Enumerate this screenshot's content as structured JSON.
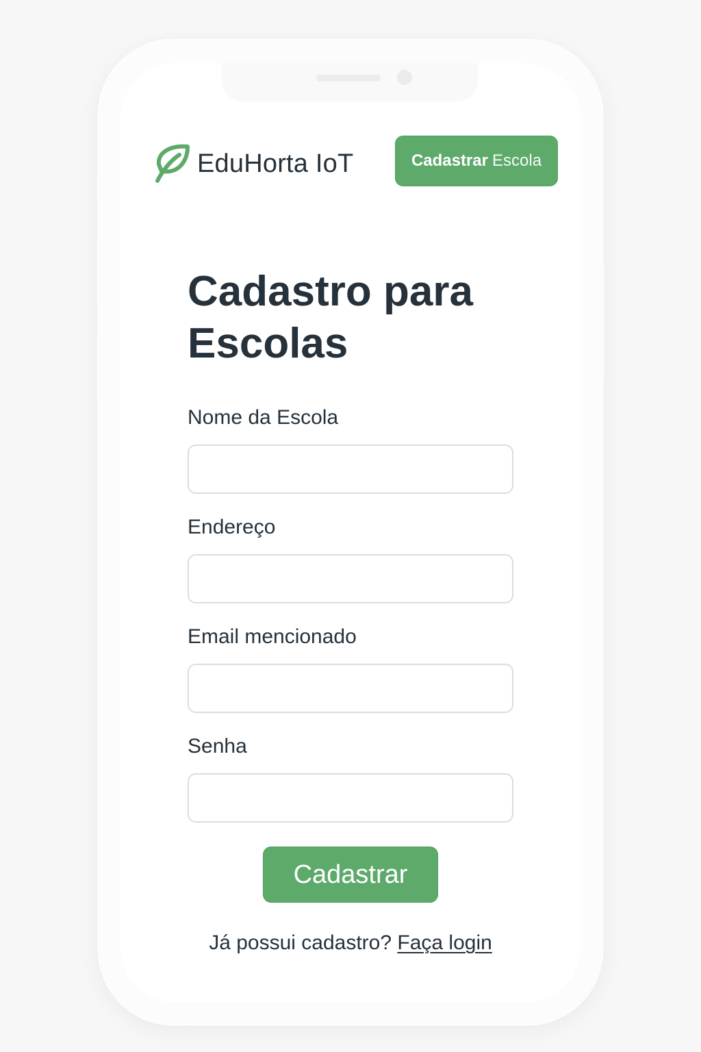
{
  "brand": {
    "name": "EduHorta IoT",
    "icon": "leaf-icon",
    "accent_color": "#5daa6b"
  },
  "header": {
    "register_button": {
      "bold_text": "Cadastrar",
      "light_text": "Escola"
    }
  },
  "form": {
    "title": "Cadastro para Escolas",
    "fields": [
      {
        "label": "Nome da Escola",
        "value": ""
      },
      {
        "label": "Endereço",
        "value": ""
      },
      {
        "label": "Email mencionado",
        "value": ""
      },
      {
        "label": "Senha",
        "value": ""
      }
    ],
    "submit_label": "Cadastrar"
  },
  "footer": {
    "question": "Já possui cadastro?",
    "login_link": "Faça login"
  }
}
